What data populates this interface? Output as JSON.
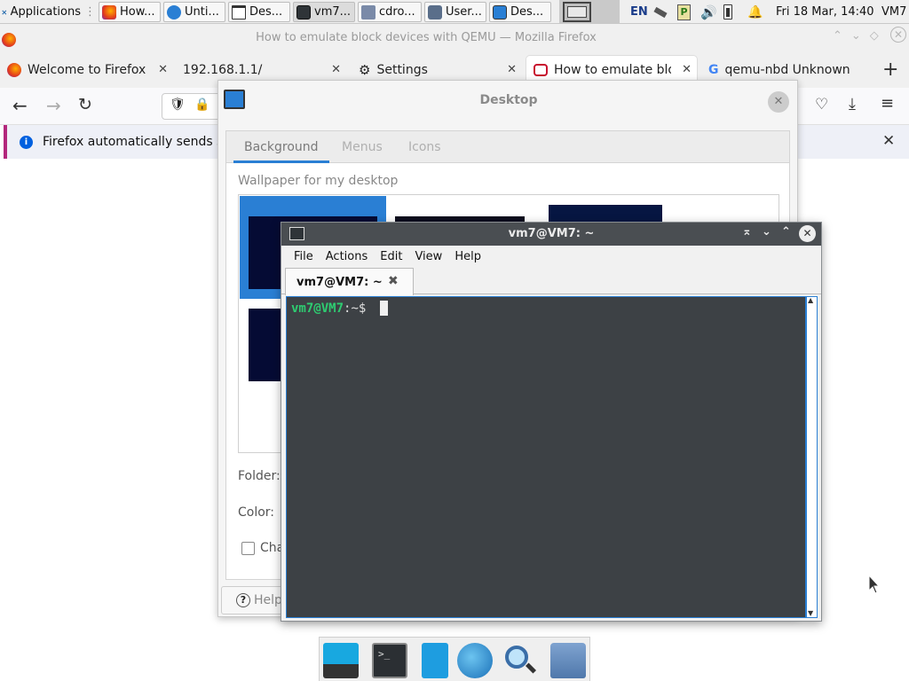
{
  "panel": {
    "applications_label": "Applications",
    "tasks": [
      {
        "label": "How...",
        "icon": "firefox-icon"
      },
      {
        "label": "Unti...",
        "icon": "web-icon"
      },
      {
        "label": "Des...",
        "icon": "window-icon"
      },
      {
        "label": "vm7...",
        "icon": "terminal-icon"
      },
      {
        "label": "cdro...",
        "icon": "folder-icon"
      },
      {
        "label": "User...",
        "icon": "users-icon"
      },
      {
        "label": "Des...",
        "icon": "desktop-icon"
      }
    ],
    "keyboard_layout": "EN",
    "clock": "Fri 18 Mar, 14:40",
    "user": "VM7"
  },
  "firefox": {
    "window_title": "How to emulate block devices with QEMU — Mozilla Firefox",
    "tabs": [
      {
        "label": "Welcome to Firefox"
      },
      {
        "label": "192.168.1.1/"
      },
      {
        "label": "Settings"
      },
      {
        "label": "How to emulate block devices with QEMU"
      },
      {
        "label": "qemu-nbd Unknown"
      }
    ],
    "notice": "Firefox automatically sends so"
  },
  "desktop_dialog": {
    "title": "Desktop",
    "tabs": [
      "Background",
      "Menus",
      "Icons"
    ],
    "selected_tab": "Background",
    "wallpaper_heading": "Wallpaper for my desktop",
    "folder_label": "Folder:",
    "color_label": "Color:",
    "change_label": "Cha",
    "help_label": "Help"
  },
  "terminal": {
    "title": "vm7@VM7: ~",
    "menu": [
      "File",
      "Actions",
      "Edit",
      "View",
      "Help"
    ],
    "tab_label": "vm7@VM7: ~",
    "prompt_user": "vm7@VM7",
    "prompt_path": ":~$",
    "colors": {
      "prompt": "#2ecc71",
      "screen_bg": "#2f3438",
      "accent": "#2a7fd4"
    }
  },
  "dock": {
    "items": [
      "show-desktop-icon",
      "terminal-icon",
      "file-manager-icon",
      "web-browser-icon",
      "app-finder-icon",
      "folder-icon"
    ]
  }
}
